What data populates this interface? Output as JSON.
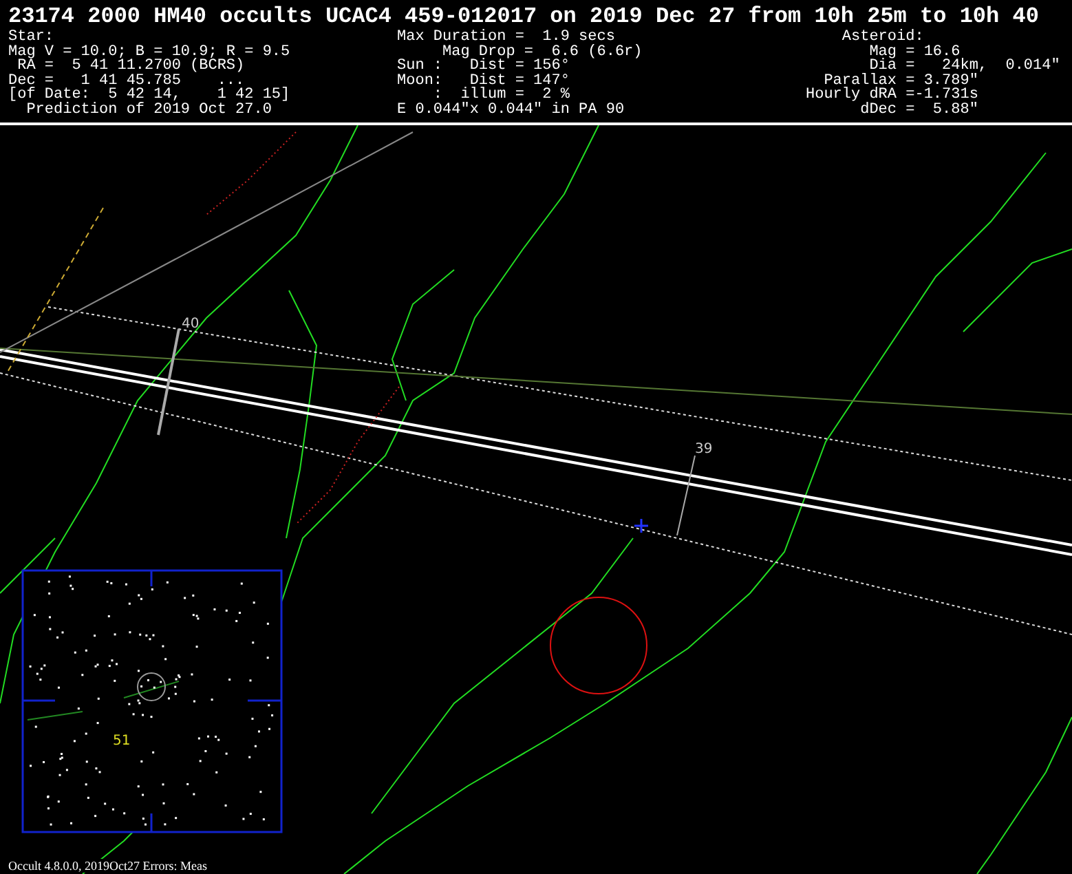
{
  "title": "23174 2000 HM40 occults UCAC4 459-012017 on 2019 Dec 27 from 10h 25m to 10h 40",
  "star_info": [
    "Star:",
    "Mag V = 10.0; B = 10.9; R = 9.5",
    " RA =  5 41 11.2700 (BCRS)",
    "Dec =   1 41 45.785    ...",
    "[of Date:  5 42 14,    1 42 15]",
    "  Prediction of 2019 Oct 27.0"
  ],
  "event_info": [
    "Max Duration =  1.9 secs",
    "     Mag Drop =  6.6 (6.6r)",
    "Sun :   Dist = 156°",
    "Moon:   Dist = 147°",
    "    :  illum =  2 %",
    "E 0.044\"x 0.044\" in PA 90"
  ],
  "asteroid_info": [
    "      Asteroid:",
    "         Mag = 16.6",
    "         Dia =   24km,  0.014\"",
    "    Parallax = 3.789\"",
    "  Hourly dRA =-1.731s",
    "        dDec =  5.88\""
  ],
  "map": {
    "time_labels": [
      "40",
      "39"
    ],
    "inset_label": "51"
  },
  "footer": "Occult 4.8.0.0, 2019Oct27  Errors: Meas"
}
